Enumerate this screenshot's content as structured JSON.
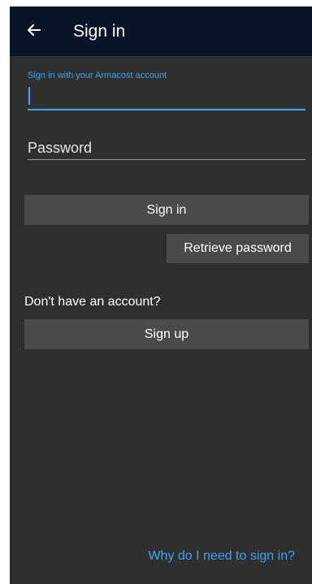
{
  "appbar": {
    "back_icon": "arrow-left-icon",
    "title": "Sign in"
  },
  "form": {
    "account_label": "Sign in with your Armacost account",
    "username_value": "",
    "password_placeholder": "Password",
    "signin_label": "Sign in",
    "retrieve_password_label": "Retrieve password"
  },
  "signup": {
    "prompt": "Don't have an account?",
    "signup_label": "Sign up"
  },
  "footer": {
    "why_link": "Why do I need to sign in?"
  },
  "colors": {
    "appbar_bg": "#0a1428",
    "background": "#2f2f2f",
    "accent": "#3fa3f5",
    "button_bg": "#4a4a4a"
  }
}
